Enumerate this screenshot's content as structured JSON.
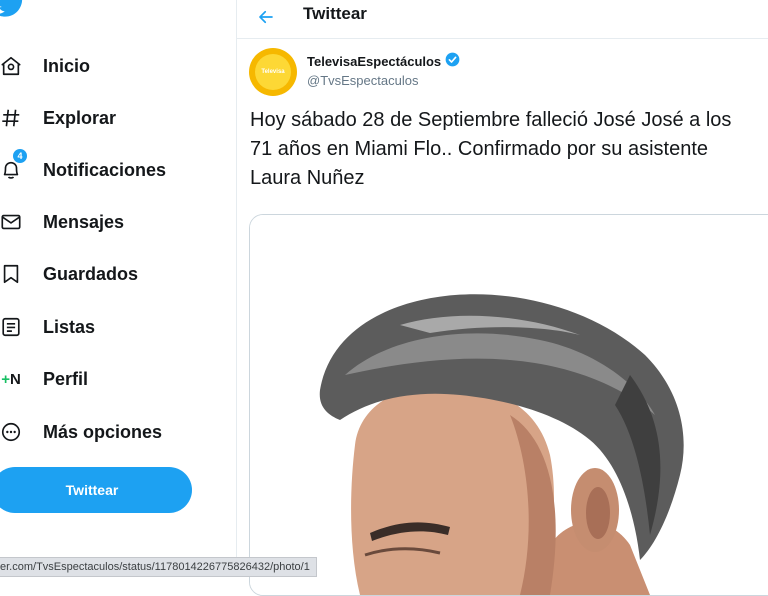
{
  "header": {
    "title": "Twittear"
  },
  "nav": {
    "items": [
      {
        "label": "Inicio",
        "icon": "home-icon"
      },
      {
        "label": "Explorar",
        "icon": "hashtag-icon"
      },
      {
        "label": "Notificaciones",
        "icon": "bell-icon",
        "badge": "4"
      },
      {
        "label": "Mensajes",
        "icon": "envelope-icon"
      },
      {
        "label": "Guardados",
        "icon": "bookmark-icon"
      },
      {
        "label": "Listas",
        "icon": "list-icon"
      },
      {
        "label": "Perfil",
        "icon": "profile-icon",
        "icon_text": "+N"
      },
      {
        "label": "Más opciones",
        "icon": "more-icon"
      }
    ],
    "tweet_button": "Twittear"
  },
  "tweet": {
    "display_name": "TelevisaEspectáculos",
    "handle": "@TvsEspectaculos",
    "avatar_text": "Televisa",
    "lines": [
      "Hoy sábado 28 de Septiembre falleció José José a los",
      "71 años en Miami Flo.. Confirmado  por su asistente",
      "Laura Nuñez"
    ]
  },
  "status_bar": {
    "url": "er.com/TvsEspectaculos/status/1178014226775826432/photo/1"
  },
  "colors": {
    "accent": "#1da1f2",
    "text": "#14171a",
    "secondary": "#657786",
    "border": "#e6ecf0"
  }
}
